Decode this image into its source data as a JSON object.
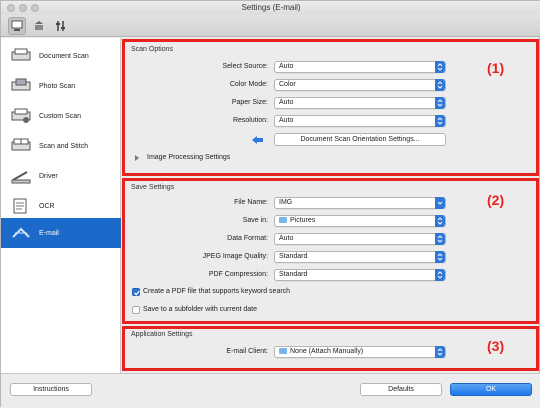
{
  "window": {
    "title": "Settings (E-mail)"
  },
  "toolbar": {
    "tabs": [
      {
        "icon": "scan-from-computer-icon"
      },
      {
        "icon": "scan-from-panel-icon"
      },
      {
        "icon": "general-settings-icon"
      }
    ]
  },
  "sidebar": {
    "items": [
      {
        "label": "Document Scan",
        "icon": "document-scan-icon"
      },
      {
        "label": "Photo Scan",
        "icon": "photo-scan-icon"
      },
      {
        "label": "Custom Scan",
        "icon": "custom-scan-icon"
      },
      {
        "label": "Scan and Stitch",
        "icon": "scan-and-stitch-icon"
      },
      {
        "label": "Driver",
        "icon": "driver-icon"
      },
      {
        "label": "OCR",
        "icon": "ocr-icon"
      },
      {
        "label": "E-mail",
        "icon": "email-icon"
      }
    ],
    "selected_index": 6
  },
  "scan_options": {
    "title": "Scan Options",
    "callout": "(1)",
    "select_source": {
      "label": "Select Source:",
      "value": "Auto"
    },
    "color_mode": {
      "label": "Color Mode:",
      "value": "Color"
    },
    "paper_size": {
      "label": "Paper Size:",
      "value": "Auto"
    },
    "resolution": {
      "label": "Resolution:",
      "value": "Auto"
    },
    "orientation_button": "Document Scan Orientation Settings...",
    "image_processing": "Image Processing Settings"
  },
  "save_settings": {
    "title": "Save Settings",
    "callout": "(2)",
    "file_name": {
      "label": "File Name:",
      "value": "IMG"
    },
    "save_in": {
      "label": "Save in:",
      "value": "Pictures"
    },
    "data_format": {
      "label": "Data Format:",
      "value": "Auto"
    },
    "jpeg_quality": {
      "label": "JPEG Image Quality:",
      "value": "Standard"
    },
    "pdf_compression": {
      "label": "PDF Compression:",
      "value": "Standard"
    },
    "create_pdf_checkbox": {
      "label": "Create a PDF file that supports keyword search",
      "checked": true
    },
    "subfolder_checkbox": {
      "label": "Save to a subfolder with current date",
      "checked": false
    }
  },
  "application_settings": {
    "title": "Application Settings",
    "callout": "(3)",
    "email_client": {
      "label": "E-mail Client:",
      "value": "None (Attach Manually)"
    }
  },
  "footer": {
    "instructions": "Instructions",
    "defaults": "Defaults",
    "ok": "OK"
  },
  "colors": {
    "highlight_frame": "#e8231f",
    "accent": "#2d78d9",
    "selection": "#1b6ac9"
  }
}
